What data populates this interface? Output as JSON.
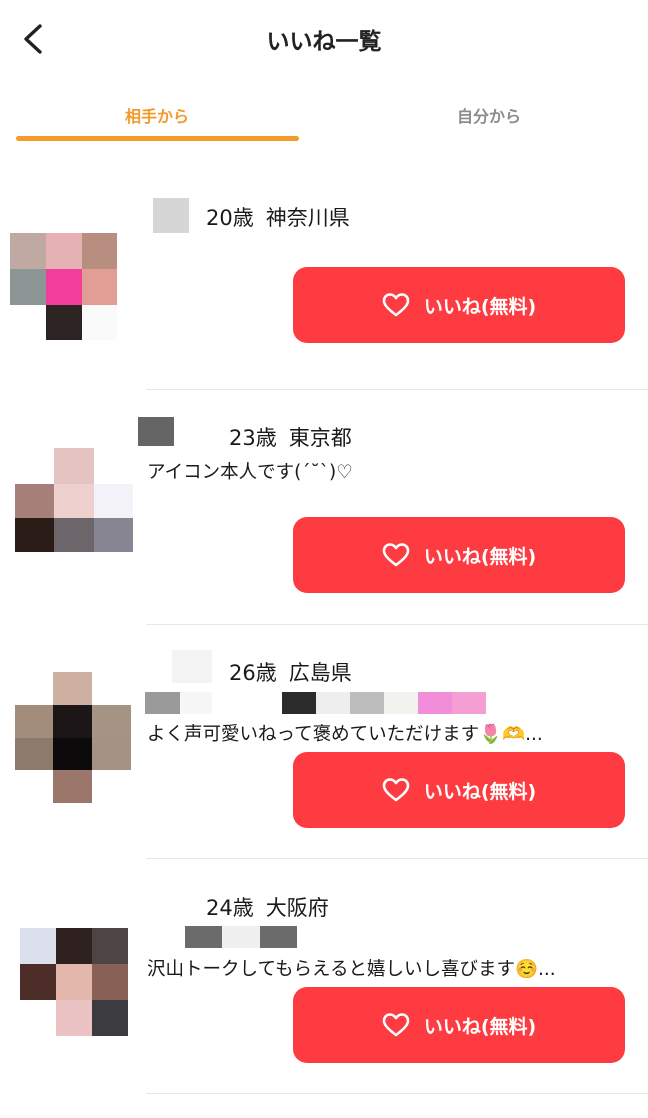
{
  "header": {
    "title": "いいね一覧",
    "back_icon": "chevron-left-icon"
  },
  "tabs": [
    {
      "label": "相手から",
      "active": true
    },
    {
      "label": "自分から",
      "active": false
    }
  ],
  "colors": {
    "accent": "#f39a2b",
    "like_button": "#fd3b41",
    "tab_inactive": "#8c8c8c"
  },
  "users": [
    {
      "age": "20歳",
      "location": "神奈川県",
      "bio": "",
      "like_label": "いいね(無料)"
    },
    {
      "age": "23歳",
      "location": "東京都",
      "bio": "アイコン本人です(ˊ˘ˋ)♡",
      "like_label": "いいね(無料)"
    },
    {
      "age": "26歳",
      "location": "広島県",
      "bio": "よく声可愛いねって褒めていただけます🌷🫶...",
      "like_label": "いいね(無料)"
    },
    {
      "age": "24歳",
      "location": "大阪府",
      "bio": "沢山トークしてもらえると嬉しいし喜びます☺️...",
      "like_label": "いいね(無料)"
    }
  ]
}
